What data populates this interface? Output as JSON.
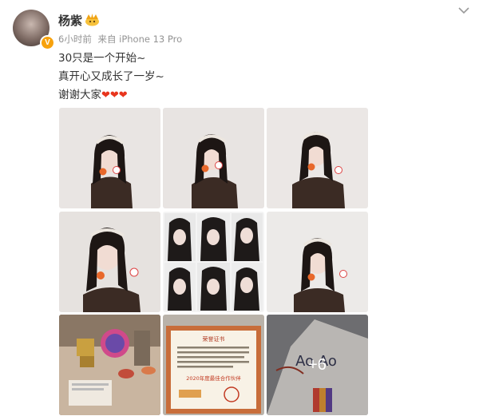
{
  "post": {
    "author": "杨紫",
    "time": "6小时前",
    "source": "来自 iPhone 13 Pro",
    "lines": [
      "30只是一个开始~",
      "真开心又成长了一岁~",
      "谢谢大家"
    ],
    "hearts": "❤❤❤"
  },
  "avatar": {
    "verified_badge": "V"
  },
  "media": {
    "photos": [
      {
        "name": "portrait-photo"
      },
      {
        "name": "portrait-photo"
      },
      {
        "name": "portrait-photo"
      },
      {
        "name": "portrait-photo"
      },
      {
        "name": "collage-photo"
      },
      {
        "name": "portrait-photo"
      },
      {
        "name": "room-photo"
      },
      {
        "name": "certificate-photo"
      },
      {
        "name": "drawing-photo"
      }
    ],
    "more_count": "+6"
  },
  "certificate": {
    "title": "荣誉证书",
    "subtitle": "2020年度最佳合作伙伴"
  },
  "drawing": {
    "text": "Ao Ao"
  },
  "colors": {
    "heart": "#e8351d",
    "badge": "#f7a20d",
    "meta": "#939393"
  }
}
